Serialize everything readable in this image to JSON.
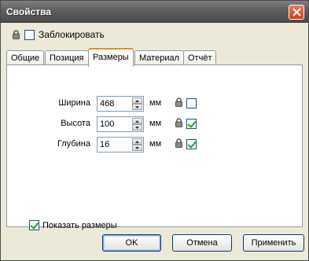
{
  "window": {
    "title": "Свойства"
  },
  "lock_row": {
    "label": "Заблокировать",
    "checked": false
  },
  "tabs": [
    {
      "label": "Общие",
      "active": false
    },
    {
      "label": "Позиция",
      "active": false
    },
    {
      "label": "Размеры",
      "active": true
    },
    {
      "label": "Материал",
      "active": false
    },
    {
      "label": "Отчёт",
      "active": false
    }
  ],
  "dimensions": [
    {
      "label": "Ширина",
      "value": "468",
      "unit": "мм",
      "locked": false
    },
    {
      "label": "Высота",
      "value": "100",
      "unit": "мм",
      "locked": true
    },
    {
      "label": "Глубина",
      "value": "16",
      "unit": "мм",
      "locked": true
    }
  ],
  "show_sizes": {
    "label": "Показать размеры",
    "checked": true
  },
  "buttons": {
    "ok": "OK",
    "cancel": "Отмена",
    "apply": "Применить"
  },
  "colors": {
    "tab_accent": "#e68b2c",
    "button_border": "#003c74",
    "titlebar": "#5e5e5e",
    "close": "#d23b17"
  }
}
